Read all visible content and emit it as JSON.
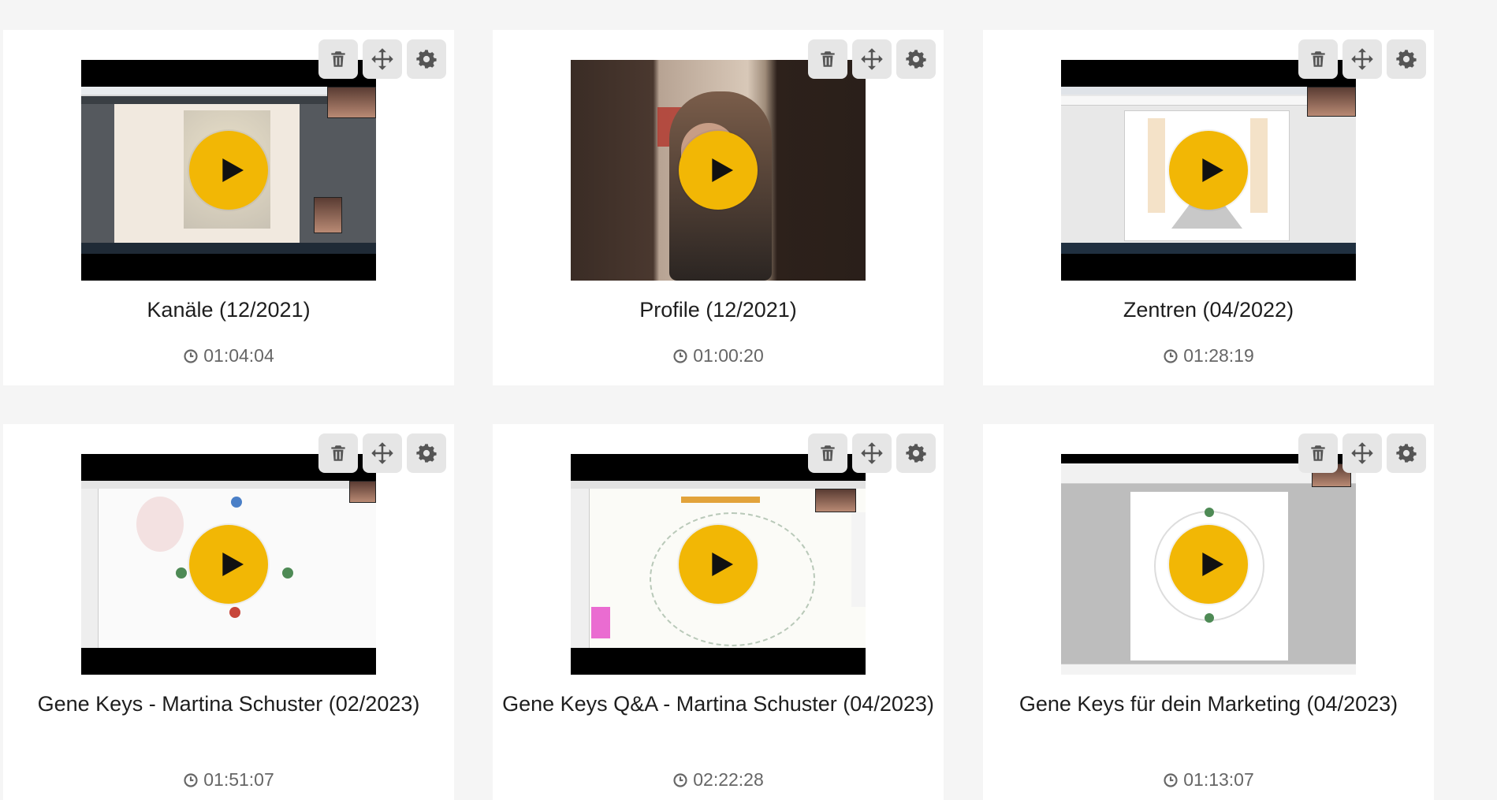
{
  "videos": [
    {
      "title": "Kanäle (12/2021)",
      "duration": "01:04:04"
    },
    {
      "title": "Profile (12/2021)",
      "duration": "01:00:20"
    },
    {
      "title": "Zentren (04/2022)",
      "duration": "01:28:19"
    },
    {
      "title": "Gene Keys - Martina Schuster (02/2023)",
      "duration": "01:51:07"
    },
    {
      "title": "Gene Keys Q&A - Martina Schuster (04/2023)",
      "duration": "02:22:28"
    },
    {
      "title": "Gene Keys für dein Marketing (04/2023)",
      "duration": "01:13:07"
    }
  ],
  "icons": {
    "delete": "trash-icon",
    "move": "move-arrows-icon",
    "settings": "gear-icon",
    "play": "play-icon",
    "duration": "clock-icon"
  },
  "colors": {
    "play_button": "#f2b705",
    "tool_background": "#e6e6e6",
    "tool_icon": "#555555",
    "page_background": "#f5f5f5"
  }
}
